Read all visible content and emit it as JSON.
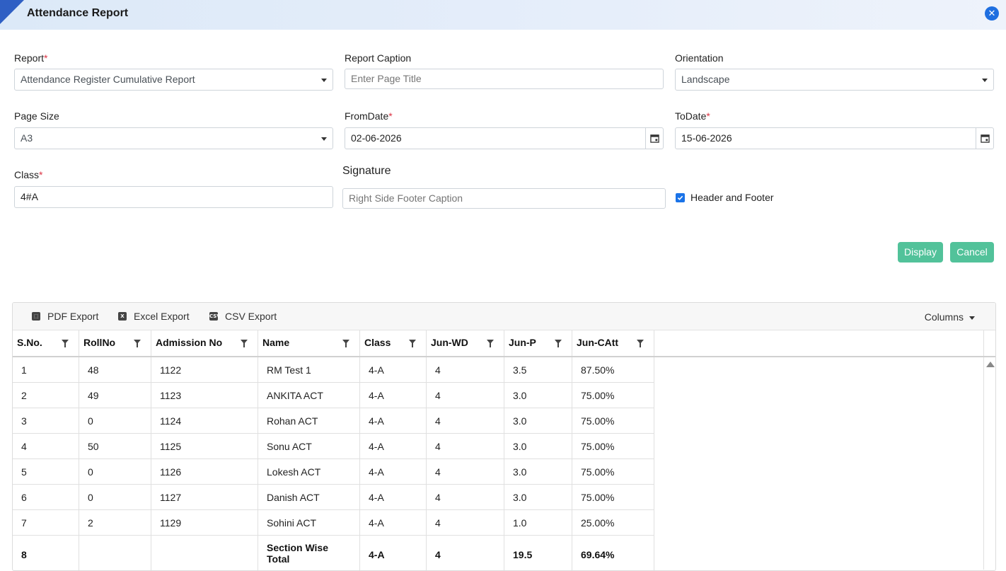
{
  "window": {
    "title": "Attendance Report"
  },
  "form": {
    "report": {
      "label": "Report",
      "value": "Attendance Register Cumulative Report"
    },
    "caption": {
      "label": "Report Caption",
      "placeholder": "Enter Page Title"
    },
    "orientation": {
      "label": "Orientation",
      "value": "Landscape"
    },
    "page_size": {
      "label": "Page Size",
      "value": "A3"
    },
    "from_date": {
      "label": "FromDate",
      "value": "02-06-2026"
    },
    "to_date": {
      "label": "ToDate",
      "value": "15-06-2026"
    },
    "class": {
      "label": "Class",
      "value": "4#A"
    },
    "signature": {
      "label": "Signature",
      "placeholder": "Right Side Footer Caption"
    },
    "header_footer": {
      "label": "Header and Footer",
      "checked": true
    },
    "required_mark": "*"
  },
  "buttons": {
    "display": "Display",
    "cancel": "Cancel"
  },
  "toolbar": {
    "pdf": "PDF Export",
    "excel": "Excel Export",
    "csv": "CSV Export",
    "columns": "Columns",
    "csv_icon_text": "CSV"
  },
  "table": {
    "headers": [
      "S.No.",
      "RollNo",
      "Admission No",
      "Name",
      "Class",
      "Jun-WD",
      "Jun-P",
      "Jun-CAtt"
    ],
    "rows": [
      [
        "1",
        "48",
        "1122",
        "RM Test 1",
        "4-A",
        "4",
        "3.5",
        "87.50%"
      ],
      [
        "2",
        "49",
        "1123",
        "ANKITA ACT",
        "4-A",
        "4",
        "3.0",
        "75.00%"
      ],
      [
        "3",
        "0",
        "1124",
        "Rohan ACT",
        "4-A",
        "4",
        "3.0",
        "75.00%"
      ],
      [
        "4",
        "50",
        "1125",
        "Sonu ACT",
        "4-A",
        "4",
        "3.0",
        "75.00%"
      ],
      [
        "5",
        "0",
        "1126",
        "Lokesh ACT",
        "4-A",
        "4",
        "3.0",
        "75.00%"
      ],
      [
        "6",
        "0",
        "1127",
        "Danish ACT",
        "4-A",
        "4",
        "3.0",
        "75.00%"
      ],
      [
        "7",
        "2",
        "1129",
        "Sohini ACT",
        "4-A",
        "4",
        "1.0",
        "25.00%"
      ]
    ],
    "total": [
      "8",
      "",
      "",
      "Section Wise Total",
      "4-A",
      "4",
      "19.5",
      "69.64%"
    ]
  },
  "colors": {
    "accent": "#52c29a",
    "brand": "#2f5fc4",
    "checkbox": "#1a73e8",
    "required": "#dc3545"
  }
}
